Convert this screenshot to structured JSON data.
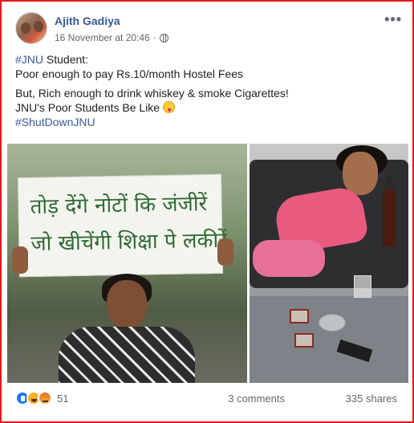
{
  "post": {
    "author": "Ajith Gadiya",
    "timestamp": "16 November at 20:46",
    "privacy_icon": "globe-icon",
    "more_icon": "more-options-icon",
    "text": {
      "line1_hashtag": "#JNU",
      "line1_rest": " Student:",
      "line2": "Poor enough to pay Rs.10/month Hostel Fees",
      "line3": "But, Rich enough to drink whiskey & smoke Cigarettes!",
      "line4": "JNU's Poor Students Be Like ",
      "line4_emoji": "tongue-out-emoji-icon",
      "line5_hashtag": "#ShutDownJNU"
    },
    "images": {
      "left": {
        "subject": "protest-photo",
        "placard_line1": "तोड़ देंगे नोटों कि जंजीरें",
        "placard_line2": "जो खीचेंगी शिक्षा पे लकीरें"
      },
      "right": {
        "subject": "party-photo"
      }
    }
  },
  "footer": {
    "reaction_icons": [
      "like-icon",
      "haha-icon",
      "angry-icon"
    ],
    "reaction_count": "51",
    "comments": "3 comments",
    "shares": "335 shares"
  },
  "colors": {
    "border": "#e4181d",
    "link": "#385898",
    "meta": "#606770"
  }
}
